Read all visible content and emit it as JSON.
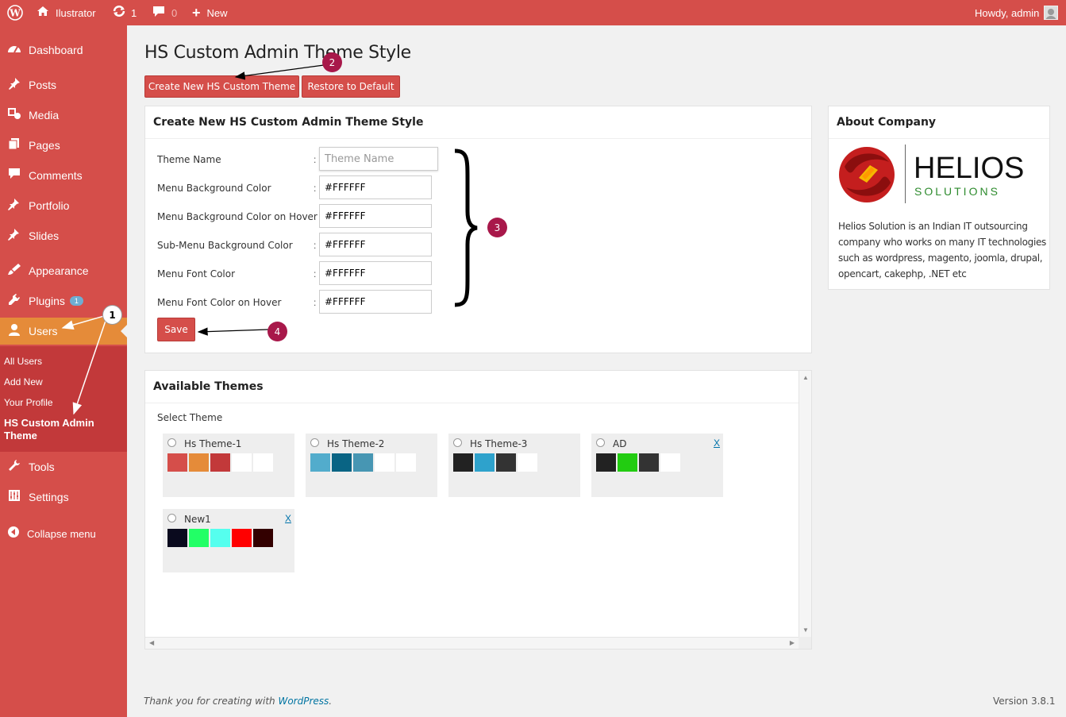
{
  "adminbar": {
    "site_name": "Ilustrator",
    "updates_count": "1",
    "comments_count": "0",
    "new_label": "New",
    "howdy": "Howdy, admin"
  },
  "sidebar": {
    "items": [
      {
        "label": "Dashboard",
        "icon": "dashboard-icon"
      },
      {
        "label": "Posts",
        "icon": "pin-icon"
      },
      {
        "label": "Media",
        "icon": "media-icon"
      },
      {
        "label": "Pages",
        "icon": "pages-icon"
      },
      {
        "label": "Comments",
        "icon": "comment-icon"
      },
      {
        "label": "Portfolio",
        "icon": "portfolio-icon"
      },
      {
        "label": "Slides",
        "icon": "slides-icon"
      },
      {
        "label": "Appearance",
        "icon": "brush-icon"
      },
      {
        "label": "Plugins",
        "icon": "plug-icon",
        "badge": "1"
      },
      {
        "label": "Users",
        "icon": "user-icon"
      },
      {
        "label": "Tools",
        "icon": "wrench-icon"
      },
      {
        "label": "Settings",
        "icon": "settings-icon"
      }
    ],
    "submenu": [
      "All Users",
      "Add New",
      "Your Profile",
      "HS Custom Admin Theme"
    ],
    "collapse": "Collapse menu"
  },
  "page": {
    "title": "HS Custom Admin Theme Style",
    "btn_create": "Create New HS Custom Theme",
    "btn_restore": "Restore to Default"
  },
  "form": {
    "title": "Create New HS Custom Admin Theme Style",
    "theme_name_label": "Theme Name",
    "theme_name_placeholder": "Theme Name",
    "fields": [
      {
        "label": "Menu Background Color",
        "value": "#FFFFFF"
      },
      {
        "label": "Menu Background Color on Hover",
        "value": "#FFFFFF"
      },
      {
        "label": "Sub-Menu Background Color",
        "value": "#FFFFFF"
      },
      {
        "label": "Menu Font Color",
        "value": "#FFFFFF"
      },
      {
        "label": "Menu Font Color on Hover",
        "value": "#FFFFFF"
      }
    ],
    "colon": ":",
    "save": "Save"
  },
  "about": {
    "title": "About Company",
    "logo_word": "HELIOS",
    "logo_sub": "SOLUTIONS",
    "text": "Helios Solution is an Indian IT outsourcing company who works on many IT technologies such as wordpress, magento, joomla, drupal, opencart, cakephp, .NET etc"
  },
  "themes": {
    "title": "Available Themes",
    "select_label": "Select Theme",
    "delete_label": "X",
    "items": [
      {
        "name": "Hs Theme-1",
        "colors": [
          "#d54e4a",
          "#e58b39",
          "#c2393a",
          "#ffffff",
          "#ffffff"
        ]
      },
      {
        "name": "Hs Theme-2",
        "colors": [
          "#52accc",
          "#096484",
          "#4796b3",
          "#ffffff",
          "#ffffff"
        ]
      },
      {
        "name": "Hs Theme-3",
        "colors": [
          "#222222",
          "#2ea2cc",
          "#333333",
          "#ffffff",
          "#eeeeee"
        ]
      },
      {
        "name": "AD",
        "colors": [
          "#222222",
          "#22cc11",
          "#333333",
          "#ffffff",
          "#eeeeee"
        ],
        "deletable": true
      },
      {
        "name": "New1",
        "colors": [
          "#0a0a1e",
          "#22ff66",
          "#55ffee",
          "#ff0000",
          "#330000"
        ],
        "deletable": true
      }
    ]
  },
  "annotations": [
    "1",
    "2",
    "3",
    "4"
  ],
  "footer": {
    "thanks_prefix": "Thank you for creating with ",
    "thanks_link": "WordPress",
    "thanks_suffix": ".",
    "version": "Version 3.8.1"
  },
  "colors": {
    "primary": "#d54e4a",
    "current": "#e58b39",
    "submenu": "#c2393a",
    "annotation": "#a8184a"
  }
}
